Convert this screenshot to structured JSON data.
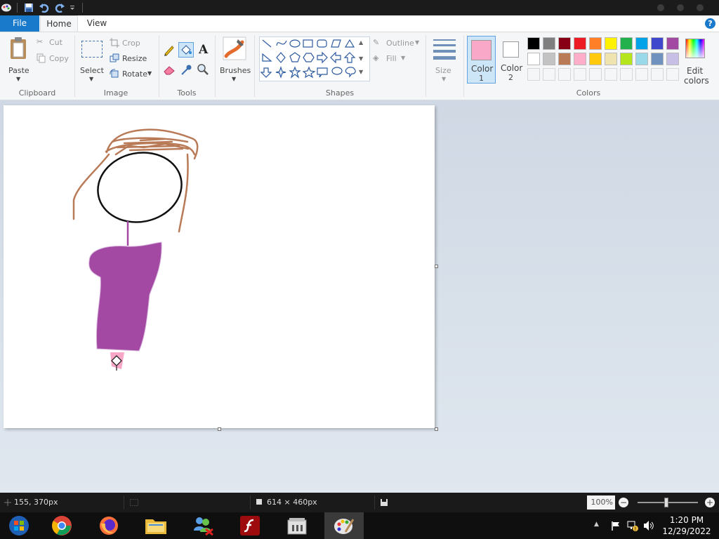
{
  "tabs": {
    "file": "File",
    "home": "Home",
    "view": "View"
  },
  "help": "?",
  "clipboard": {
    "paste": "Paste",
    "cut": "Cut",
    "copy": "Copy",
    "label": "Clipboard"
  },
  "image": {
    "select": "Select",
    "crop": "Crop",
    "resize": "Resize",
    "rotate": "Rotate",
    "label": "Image"
  },
  "tools": {
    "text_glyph": "A",
    "label": "Tools"
  },
  "brushes": {
    "label": "Brushes"
  },
  "shapes": {
    "outline": "Outline",
    "fill": "Fill",
    "label": "Shapes"
  },
  "size": {
    "label": "Size"
  },
  "color1": {
    "label": "Color",
    "number": "1",
    "value": "#f9a8c8"
  },
  "color2": {
    "label": "Color",
    "number": "2",
    "value": "#ffffff"
  },
  "colors": {
    "label": "Colors",
    "row1": [
      "#000000",
      "#7f7f7f",
      "#880015",
      "#ed1c24",
      "#ff7f27",
      "#fff200",
      "#22b14c",
      "#00a2e8",
      "#3f48cc",
      "#a349a4"
    ],
    "row2": [
      "#ffffff",
      "#c3c3c3",
      "#b97a57",
      "#ffaec9",
      "#ffc90e",
      "#efe4b0",
      "#b5e61d",
      "#99d9ea",
      "#7092be",
      "#c8bfe7"
    ],
    "edit_line1": "Edit",
    "edit_line2": "colors"
  },
  "status": {
    "cursor_position": "155, 370px",
    "canvas_size": "614 × 460px",
    "zoom": "100%"
  },
  "clock": {
    "time": "1:20 PM",
    "date": "12/29/2022"
  }
}
